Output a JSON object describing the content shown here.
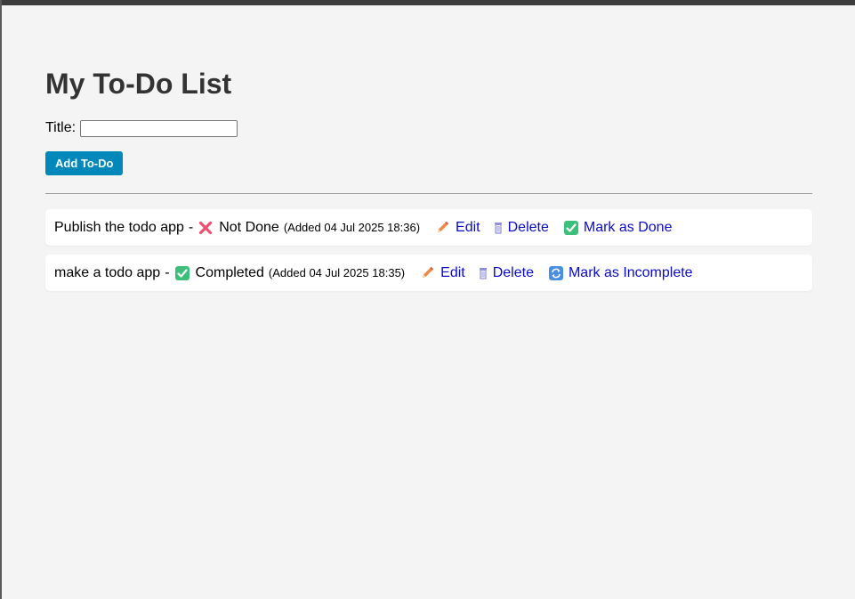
{
  "page": {
    "title": "My To-Do List"
  },
  "form": {
    "title_label": "Title:",
    "title_value": "",
    "add_button": "Add To-Do"
  },
  "todos": [
    {
      "title": "Publish the todo app",
      "separator": "-",
      "status_icon": "cross-mark-icon",
      "status": "Not Done",
      "added": "(Added 04 Jul 2025 18:36)",
      "edit_label": "Edit",
      "delete_label": "Delete",
      "toggle_icon": "check-box-icon",
      "toggle_label": "Mark as Done"
    },
    {
      "title": "make a todo app",
      "separator": "-",
      "status_icon": "check-box-icon",
      "status": "Completed",
      "added": "(Added 04 Jul 2025 18:35)",
      "edit_label": "Edit",
      "delete_label": "Delete",
      "toggle_icon": "refresh-icon",
      "toggle_label": "Mark as Incomplete"
    }
  ],
  "colors": {
    "background": "#f4f4f4",
    "button": "#0088bb",
    "link": "#0a0acc",
    "heading": "#333333"
  }
}
